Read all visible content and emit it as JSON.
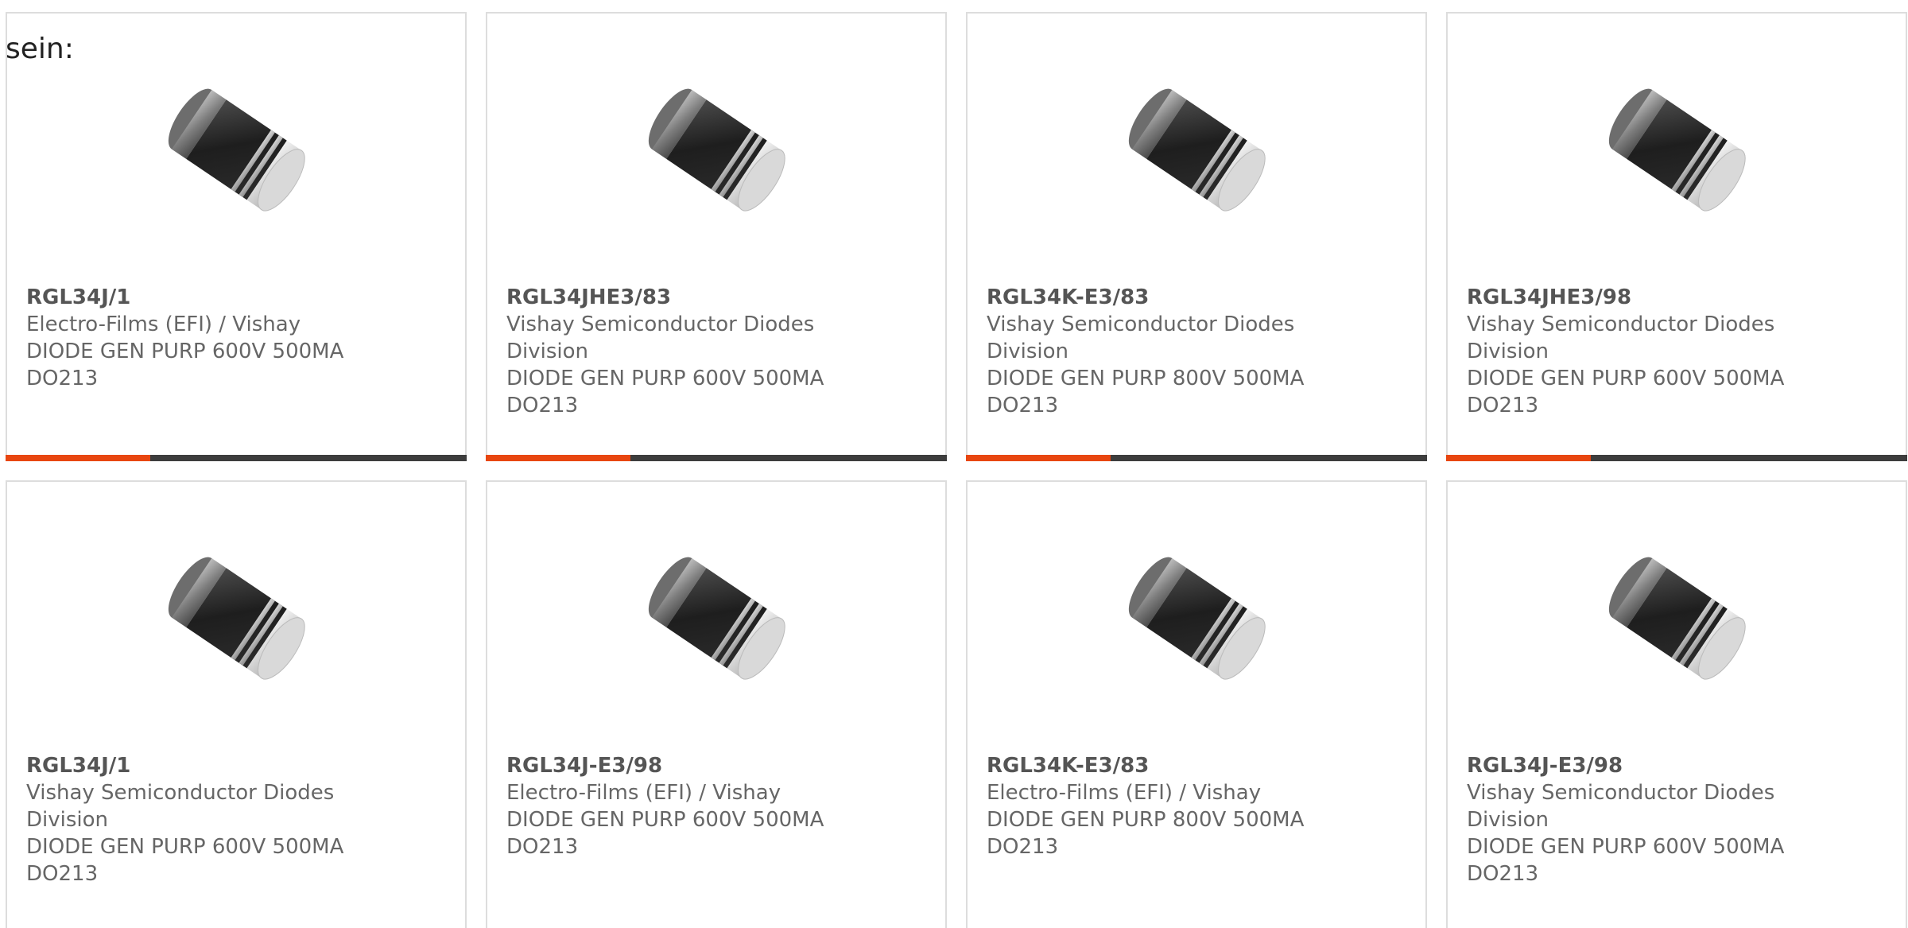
{
  "intro_text": "sein:",
  "colors": {
    "accent": "#e84610",
    "bar": "#3d3d3d",
    "border": "#dddddd",
    "text": "#666666"
  },
  "products": [
    {
      "part": "RGL34J/1",
      "manufacturer": "Electro-Films (EFI) / Vishay",
      "description": "DIODE GEN PURP 600V 500MA DO213",
      "image_icon": "diode-icon"
    },
    {
      "part": "RGL34JHE3/83",
      "manufacturer": "Vishay Semiconductor Diodes Division",
      "description": "DIODE GEN PURP 600V 500MA DO213",
      "image_icon": "diode-icon"
    },
    {
      "part": "RGL34K-E3/83",
      "manufacturer": "Vishay Semiconductor Diodes Division",
      "description": "DIODE GEN PURP 800V 500MA DO213",
      "image_icon": "diode-icon"
    },
    {
      "part": "RGL34JHE3/98",
      "manufacturer": "Vishay Semiconductor Diodes Division",
      "description": "DIODE GEN PURP 600V 500MA DO213",
      "image_icon": "diode-icon"
    },
    {
      "part": "RGL34J/1",
      "manufacturer": "Vishay Semiconductor Diodes Division",
      "description": "DIODE GEN PURP 600V 500MA DO213",
      "image_icon": "diode-icon"
    },
    {
      "part": "RGL34J-E3/98",
      "manufacturer": "Electro-Films (EFI) / Vishay",
      "description": "DIODE GEN PURP 600V 500MA DO213",
      "image_icon": "diode-icon"
    },
    {
      "part": "RGL34K-E3/83",
      "manufacturer": "Electro-Films (EFI) / Vishay",
      "description": "DIODE GEN PURP 800V 500MA DO213",
      "image_icon": "diode-icon"
    },
    {
      "part": "RGL34J-E3/98",
      "manufacturer": "Vishay Semiconductor Diodes Division",
      "description": "DIODE GEN PURP 600V 500MA DO213",
      "image_icon": "diode-icon"
    }
  ]
}
